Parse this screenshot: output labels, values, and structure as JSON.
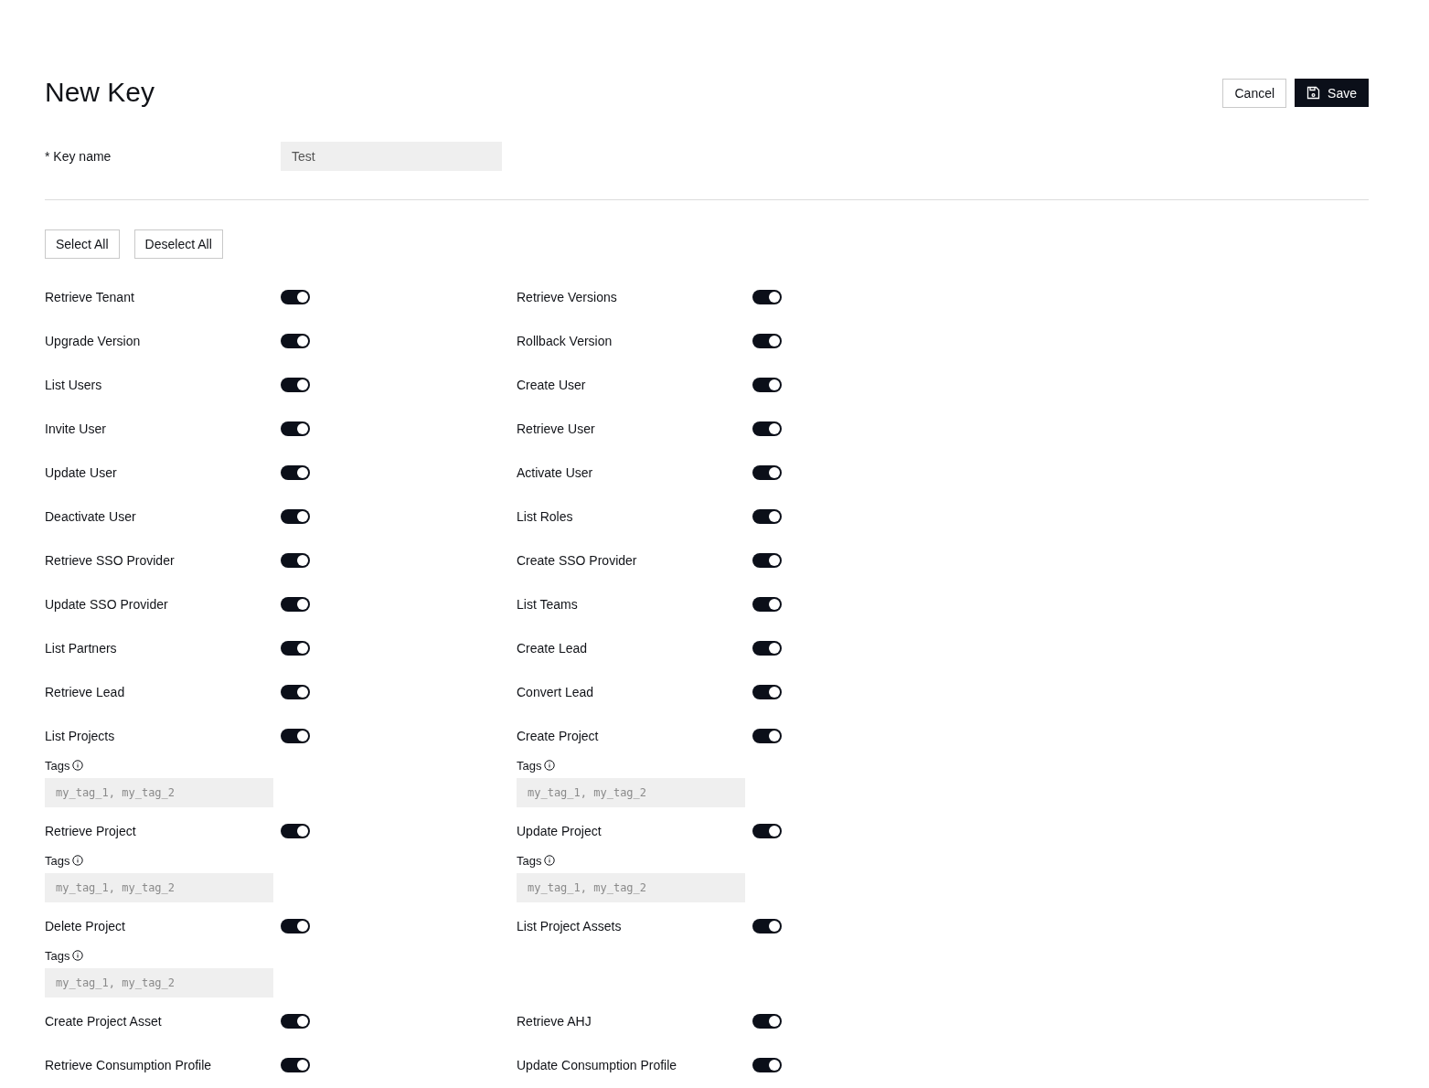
{
  "title": "New Key",
  "actions": [
    {
      "label": "Cancel",
      "kind": "secondary"
    },
    {
      "label": "Save",
      "kind": "primary"
    }
  ],
  "key_name": {
    "label": "* Key name",
    "value": "Test"
  },
  "bulk_buttons": [
    "Select All",
    "Deselect All"
  ],
  "permissions": [
    {
      "label": "Retrieve Tenant",
      "on": true
    },
    {
      "label": "Retrieve Versions",
      "on": true
    },
    {
      "label": "Upgrade Version",
      "on": true
    },
    {
      "label": "Rollback Version",
      "on": true
    },
    {
      "label": "List Users",
      "on": true
    },
    {
      "label": "Create User",
      "on": true
    },
    {
      "label": "Invite User",
      "on": true
    },
    {
      "label": "Retrieve User",
      "on": true
    },
    {
      "label": "Update User",
      "on": true
    },
    {
      "label": "Activate User",
      "on": true
    },
    {
      "label": "Deactivate User",
      "on": true
    },
    {
      "label": "List Roles",
      "on": true
    },
    {
      "label": "Retrieve SSO Provider",
      "on": true
    },
    {
      "label": "Create SSO Provider",
      "on": true
    },
    {
      "label": "Update SSO Provider",
      "on": true
    },
    {
      "label": "List Teams",
      "on": true
    },
    {
      "label": "List Partners",
      "on": true
    },
    {
      "label": "Create Lead",
      "on": true
    },
    {
      "label": "Retrieve Lead",
      "on": true
    },
    {
      "label": "Convert Lead",
      "on": true
    },
    {
      "label": "List Projects",
      "on": true,
      "tags": {
        "label": "Tags",
        "placeholder": "my_tag_1, my_tag_2"
      }
    },
    {
      "label": "Create Project",
      "on": true,
      "tags": {
        "label": "Tags",
        "placeholder": "my_tag_1, my_tag_2"
      }
    },
    {
      "label": "Retrieve Project",
      "on": true,
      "tags": {
        "label": "Tags",
        "placeholder": "my_tag_1, my_tag_2"
      }
    },
    {
      "label": "Update Project",
      "on": true,
      "tags": {
        "label": "Tags",
        "placeholder": "my_tag_1, my_tag_2"
      }
    },
    {
      "label": "Delete Project",
      "on": true,
      "tags": {
        "label": "Tags",
        "placeholder": "my_tag_1, my_tag_2"
      }
    },
    {
      "label": "List Project Assets",
      "on": true
    },
    {
      "label": "Create Project Asset",
      "on": true
    },
    {
      "label": "Retrieve AHJ",
      "on": true
    },
    {
      "label": "Retrieve Consumption Profile",
      "on": true
    },
    {
      "label": "Update Consumption Profile",
      "on": true
    }
  ]
}
